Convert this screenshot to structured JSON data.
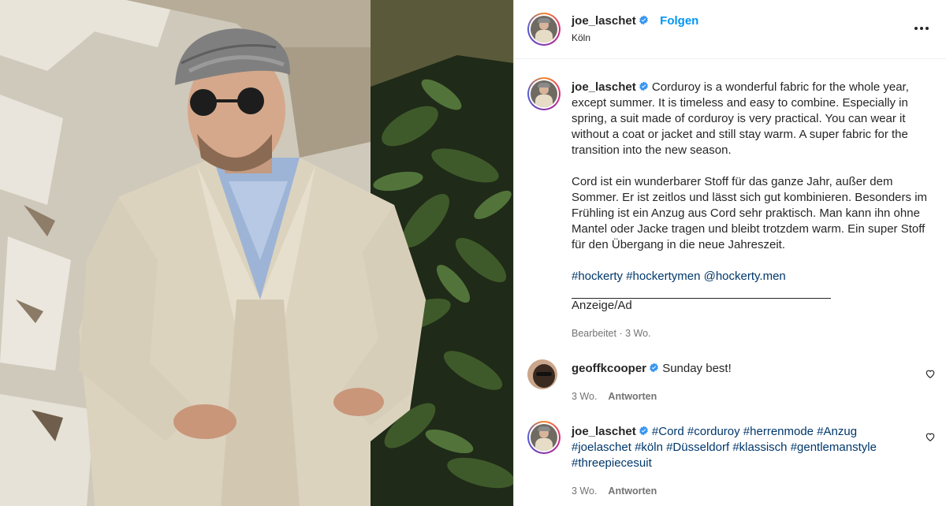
{
  "post": {
    "author": "joe_laschet",
    "follow_label": "Folgen",
    "location": "Köln",
    "caption_en": "Corduroy is a wonderful fabric for the whole year, except summer. It is timeless and easy to combine. Especially in spring, a suit made of corduroy is very practical. You can wear it without a coat or jacket and still stay warm. A super fabric for the transition into the new season.",
    "caption_de": "Cord ist ein wunderbarer Stoff für das ganze Jahr, außer dem Sommer. Er ist zeitlos und lässt sich gut kombinieren. Besonders im Frühling ist ein Anzug aus Cord sehr praktisch. Man kann ihn ohne Mantel oder Jacke tragen und bleibt trotzdem warm. Ein super Stoff für den Übergang in die neue Jahreszeit.",
    "tags": [
      "#hockerty",
      "#hockertymen",
      "@hockerty.men"
    ],
    "disclosure": "Anzeige/Ad",
    "edited_label": "Bearbeitet",
    "age": "3 Wo."
  },
  "comments": [
    {
      "author": "geoffkcooper",
      "text": "Sunday best!",
      "age": "3 Wo.",
      "reply_label": "Antworten"
    },
    {
      "author": "joe_laschet",
      "tags": [
        "#Cord",
        "#corduroy",
        "#herrenmode",
        "#Anzug",
        "#joelaschet",
        "#köln",
        "#Düsseldorf",
        "#klassisch",
        "#gentlemanstyle",
        "#threepiecesuit"
      ],
      "age": "3 Wo.",
      "reply_label": "Antworten"
    }
  ],
  "colors": {
    "accent": "#0095f6",
    "hashtag": "#00376b",
    "verified": "#3897f0",
    "muted": "#737373"
  },
  "icons": [
    "verified-badge-icon",
    "more-options-icon",
    "heart-icon"
  ]
}
